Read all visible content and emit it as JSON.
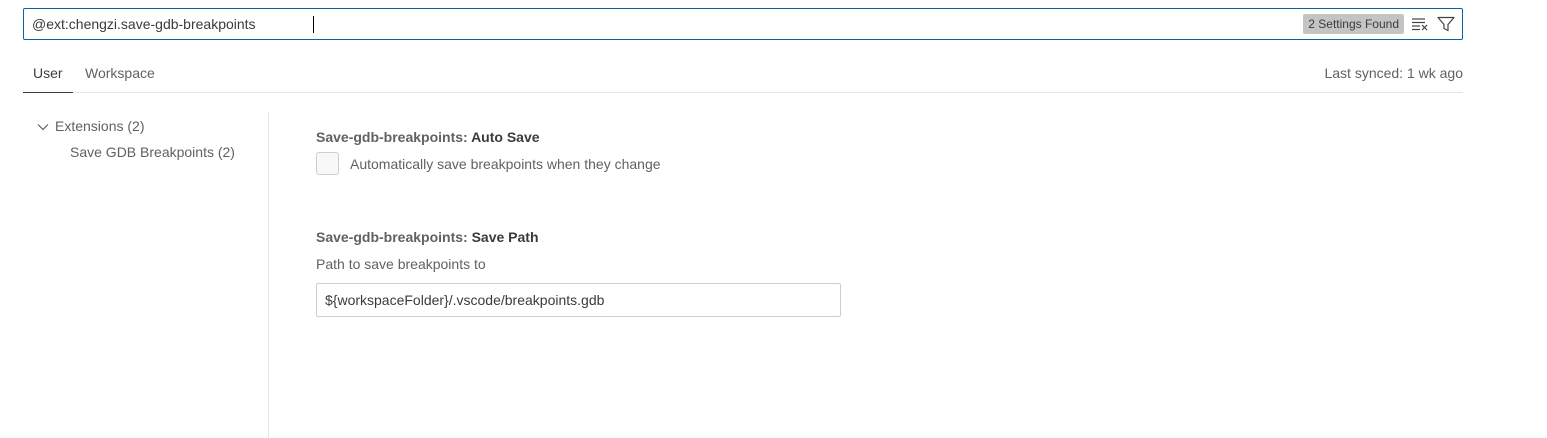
{
  "search": {
    "value": "@ext:chengzi.save-gdb-breakpoints",
    "count_badge": "2 Settings Found",
    "clear_icon": "clear-filter-icon",
    "filter_icon": "filter-icon"
  },
  "tabs": [
    {
      "label": "User",
      "active": true
    },
    {
      "label": "Workspace",
      "active": false
    }
  ],
  "sync_status": "Last synced: 1 wk ago",
  "toc": {
    "group_label": "Extensions (2)",
    "items": [
      {
        "label": "Save GDB Breakpoints (2)"
      }
    ]
  },
  "settings": [
    {
      "category": "Save-gdb-breakpoints: ",
      "name": "Auto Save",
      "type": "checkbox",
      "checked": false,
      "label": "Automatically save breakpoints when they change"
    },
    {
      "category": "Save-gdb-breakpoints: ",
      "name": "Save Path",
      "type": "text",
      "description": "Path to save breakpoints to",
      "value": "${workspaceFolder}/.vscode/breakpoints.gdb"
    }
  ],
  "colors": {
    "focus_border": "#0e639c",
    "badge_bg": "#c4c4c4",
    "text": "#616161",
    "text_strong": "#3b3b3b"
  }
}
